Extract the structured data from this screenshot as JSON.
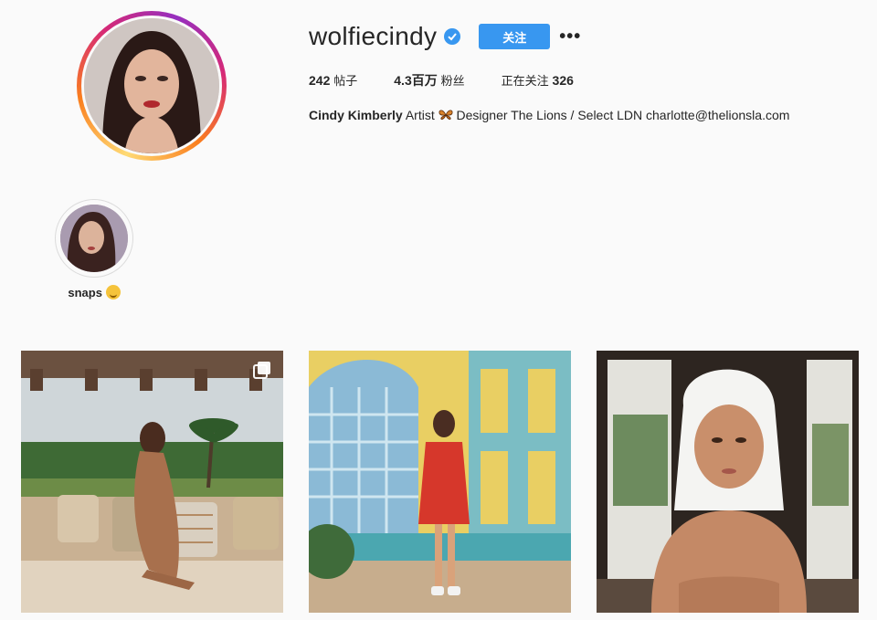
{
  "profile": {
    "username": "wolfiecindy",
    "verified": true,
    "follow_label": "关注",
    "more_label": "•••",
    "stats": {
      "posts_value": "242",
      "posts_label": "帖子",
      "followers_value": "4.3百万",
      "followers_label": "粉丝",
      "following_label": "正在关注",
      "following_value": "326"
    },
    "bio": {
      "full_name": "Cindy Kimberly",
      "text_before_emoji": "Artist",
      "emoji": "butterfly-emoji",
      "text_after_emoji": "Designer The Lions / Select LDN charlotte@thelionsla.com"
    }
  },
  "highlights": [
    {
      "label": "snaps",
      "emoji": "smiling-face-emoji"
    }
  ],
  "posts": [
    {
      "type": "carousel",
      "icon": "multiple-images-icon"
    },
    {
      "type": "photo"
    },
    {
      "type": "photo"
    }
  ],
  "colors": {
    "accent_blue": "#3897f0",
    "background": "#fafafa",
    "text": "#262626"
  }
}
